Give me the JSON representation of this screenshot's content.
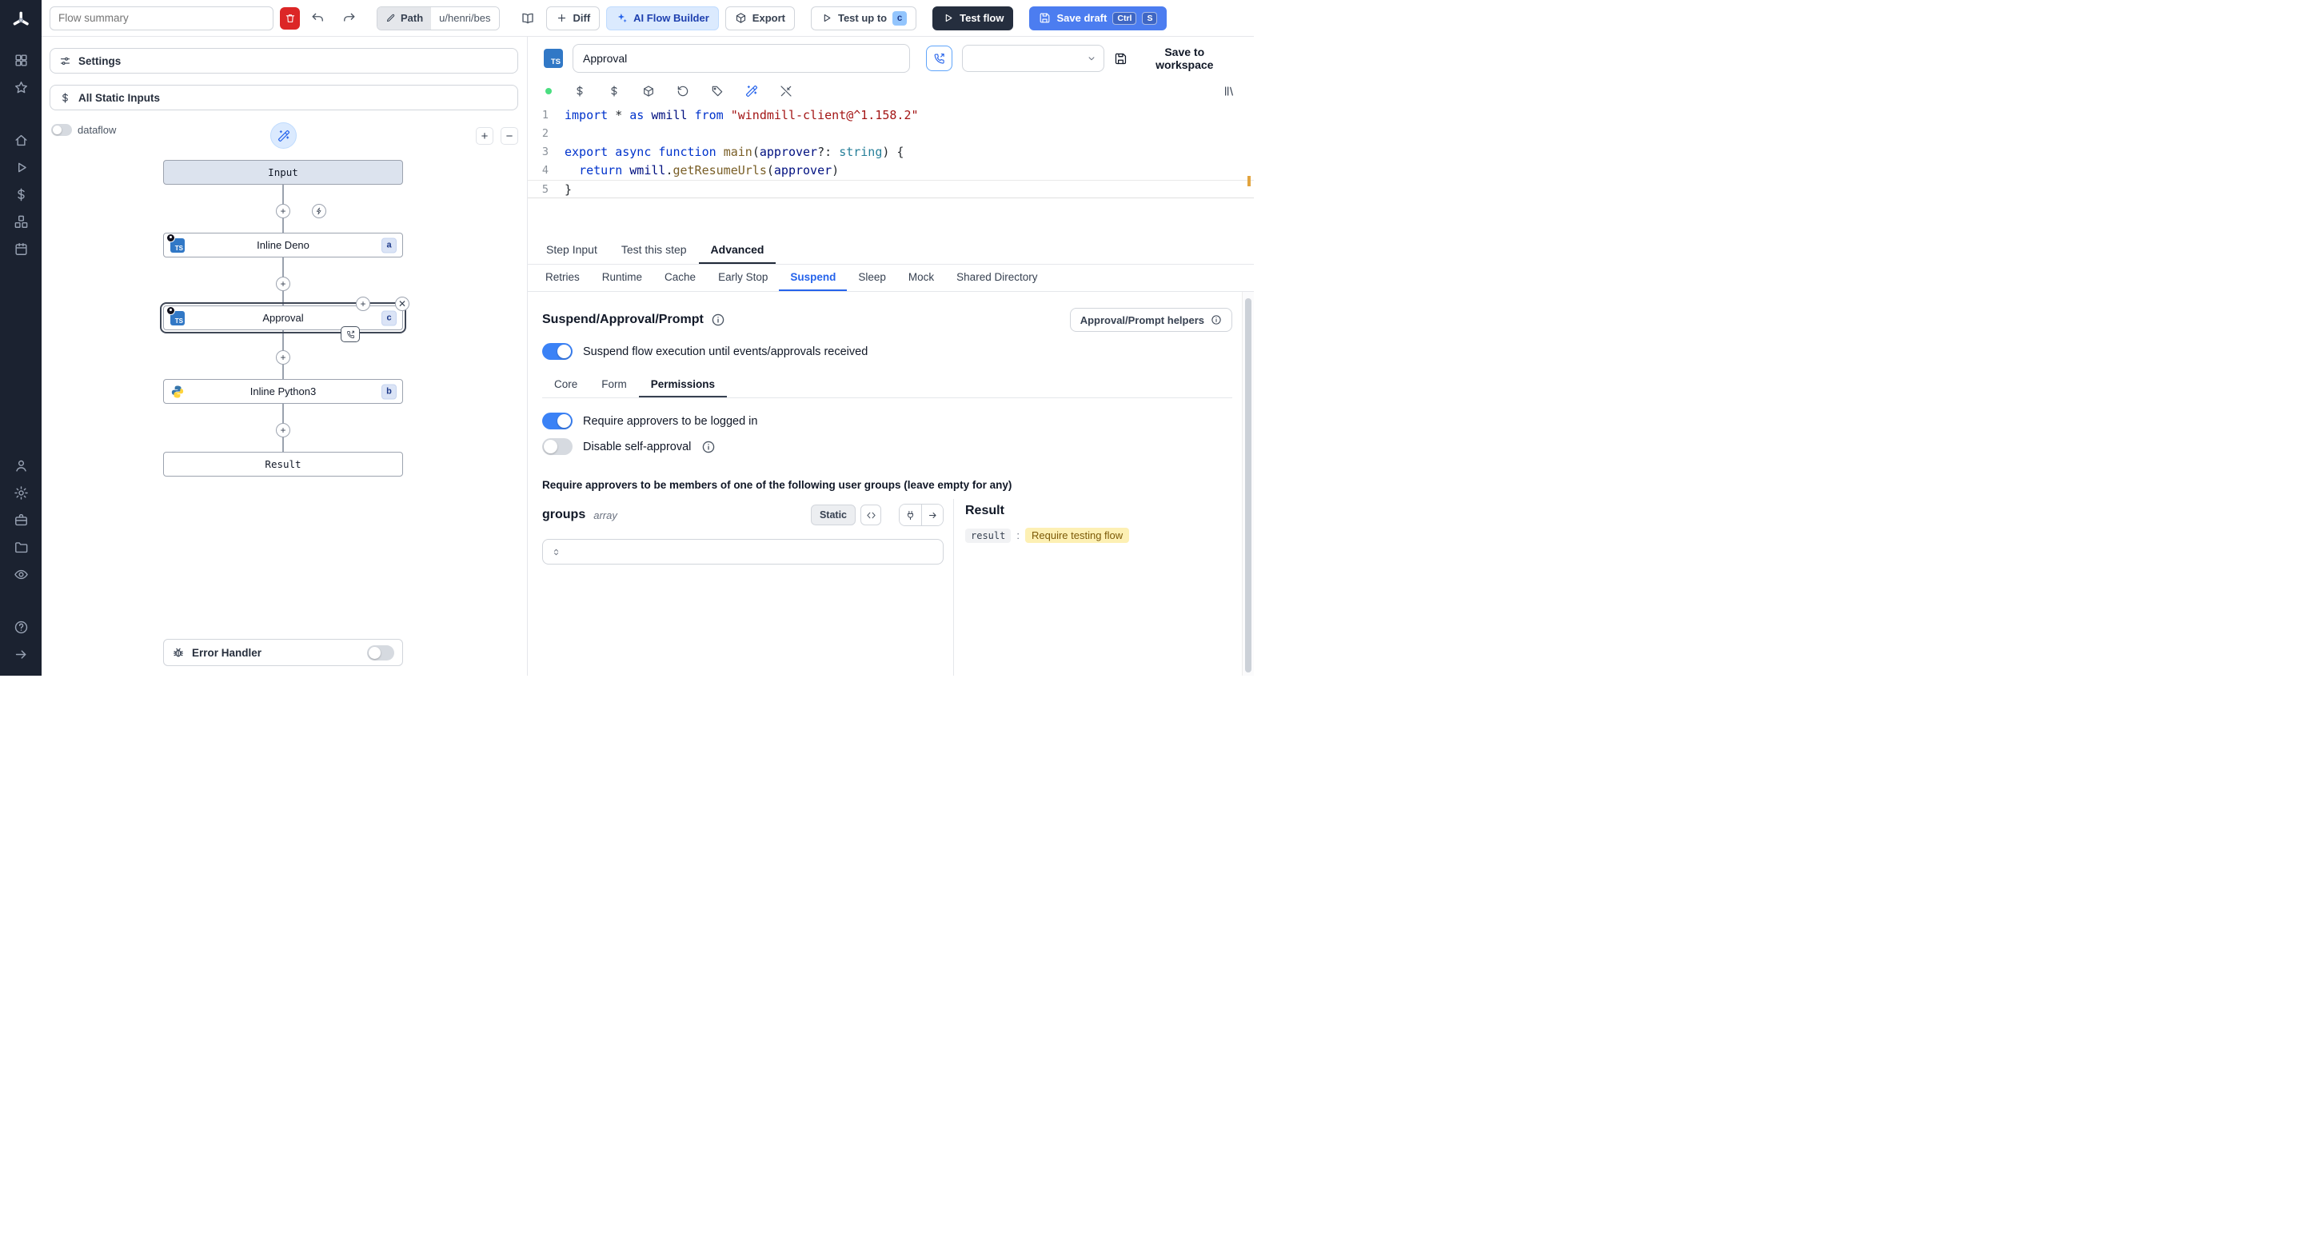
{
  "colors": {
    "accent_blue": "#3b82f6",
    "ai_button_bg": "#dbeafe",
    "test_flow_bg": "#252e3e",
    "save_draft_bg": "#4c7df0",
    "danger_red": "#dc2626",
    "ts_logo_blue": "#3178c6",
    "toggle_on": "#3b82f6",
    "result_highlight_bg": "#fdf0b4",
    "sidebar_bg": "#1b2230"
  },
  "glyphs": {
    "plus": "+",
    "minus": "−",
    "close": "✕",
    "colon": ":"
  },
  "sidebar": {
    "icons": [
      "windmill-logo",
      "grid-apps",
      "star",
      "home",
      "runs-play",
      "variables-dollar",
      "resources-boxes",
      "schedules-calendar",
      "users",
      "settings-gear",
      "workers-briefcase",
      "folders",
      "audit-eye",
      "help",
      "collapse-arrow"
    ]
  },
  "topbar": {
    "flow_summary_placeholder": "Flow summary",
    "path_label": "Path",
    "path_value": "u/henri/bes",
    "diff_label": "Diff",
    "ai_flow_builder_label": "AI Flow Builder",
    "export_label": "Export",
    "test_up_to_label": "Test up to",
    "test_up_to_badge": "c",
    "test_flow_label": "Test flow",
    "save_draft_label": "Save draft",
    "kbd_ctrl": "Ctrl",
    "kbd_s": "S"
  },
  "flow": {
    "settings_label": "Settings",
    "static_inputs_label": "All Static Inputs",
    "dataflow_label": "dataflow",
    "nodes": {
      "input_label": "Input",
      "deno_label": "Inline Deno",
      "deno_badge": "a",
      "approval_label": "Approval",
      "approval_badge": "c",
      "python_label": "Inline Python3",
      "python_badge": "b",
      "result_label": "Result"
    },
    "error_handler_label": "Error Handler"
  },
  "step": {
    "ts_label": "TS",
    "name_value": "Approval",
    "save_to_workspace_label": "Save to workspace"
  },
  "code": {
    "active_line": 4,
    "lines": [
      [
        {
          "c": "k",
          "t": "import"
        },
        {
          "c": "p",
          "t": " * "
        },
        {
          "c": "k",
          "t": "as"
        },
        {
          "c": "v",
          "t": " wmill "
        },
        {
          "c": "k",
          "t": "from"
        },
        {
          "c": "p",
          "t": " "
        },
        {
          "c": "s",
          "t": "\"windmill-client@^1.158.2\""
        }
      ],
      [],
      [
        {
          "c": "k",
          "t": "export"
        },
        {
          "c": "p",
          "t": " "
        },
        {
          "c": "k",
          "t": "async"
        },
        {
          "c": "p",
          "t": " "
        },
        {
          "c": "k",
          "t": "function"
        },
        {
          "c": "p",
          "t": " "
        },
        {
          "c": "f",
          "t": "main"
        },
        {
          "c": "p",
          "t": "("
        },
        {
          "c": "v",
          "t": "approver"
        },
        {
          "c": "p",
          "t": "?: "
        },
        {
          "c": "t",
          "t": "string"
        },
        {
          "c": "p",
          "t": ") {"
        }
      ],
      [
        {
          "c": "p",
          "t": "  "
        },
        {
          "c": "k",
          "t": "return"
        },
        {
          "c": "p",
          "t": " "
        },
        {
          "c": "v",
          "t": "wmill"
        },
        {
          "c": "p",
          "t": "."
        },
        {
          "c": "f",
          "t": "getResumeUrls"
        },
        {
          "c": "p",
          "t": "("
        },
        {
          "c": "v",
          "t": "approver"
        },
        {
          "c": "p",
          "t": ")"
        }
      ],
      [
        {
          "c": "p",
          "t": "}"
        }
      ]
    ]
  },
  "tabs_primary": {
    "items": [
      {
        "label": "Step Input",
        "active": false
      },
      {
        "label": "Test this step",
        "active": false
      },
      {
        "label": "Advanced",
        "active": true
      }
    ]
  },
  "tabs_secondary": {
    "items": [
      {
        "label": "Retries",
        "active": false
      },
      {
        "label": "Runtime",
        "active": false
      },
      {
        "label": "Cache",
        "active": false
      },
      {
        "label": "Early Stop",
        "active": false
      },
      {
        "label": "Suspend",
        "active": true
      },
      {
        "label": "Sleep",
        "active": false
      },
      {
        "label": "Mock",
        "active": false
      },
      {
        "label": "Shared Directory",
        "active": false
      }
    ]
  },
  "suspend": {
    "title": "Suspend/Approval/Prompt",
    "helpers_label": "Approval/Prompt helpers",
    "suspend_toggle_label": "Suspend flow execution until events/approvals received",
    "subtabs": {
      "items": [
        {
          "label": "Core",
          "active": false
        },
        {
          "label": "Form",
          "active": false
        },
        {
          "label": "Permissions",
          "active": true
        }
      ]
    },
    "require_login_label": "Require approvers to be logged in",
    "disable_self_label": "Disable self-approval",
    "note": "Require approvers to be members of one of the following user groups (leave empty for any)",
    "groups": {
      "name": "groups",
      "type_label": "array",
      "static_label": "Static"
    },
    "result": {
      "title": "Result",
      "key": "result",
      "value": "Require testing flow"
    }
  }
}
